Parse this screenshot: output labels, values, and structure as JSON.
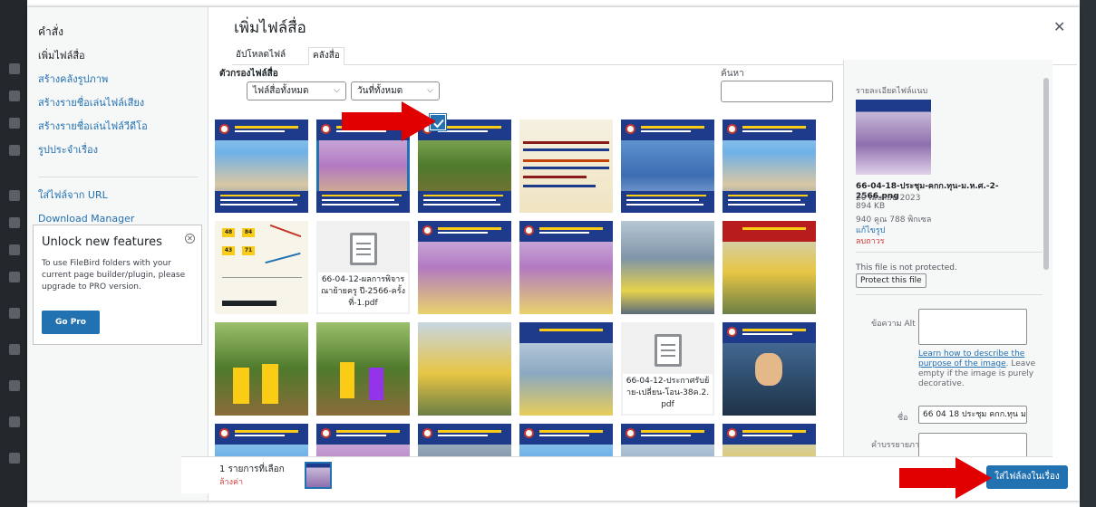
{
  "sidebar": {
    "title": "คำสั่ง",
    "items": [
      {
        "label": "เพิ่มไฟล์สื่อ",
        "active": true
      },
      {
        "label": "สร้างคลังรูปภาพ"
      },
      {
        "label": "สร้างรายชื่อเล่นไฟล์เสียง"
      },
      {
        "label": "สร้างรายชื่อเล่นไฟล์วีดีโอ"
      },
      {
        "label": "รูปประจำเรื่อง"
      }
    ],
    "extra": [
      "ใส่ไฟล์จาก URL",
      "Download Manager"
    ]
  },
  "promo": {
    "title": "Unlock new features",
    "text": "To use FileBird folders with your current page builder/plugin, please upgrade to PRO version.",
    "button": "Go Pro"
  },
  "header": {
    "title": "เพิ่มไฟล์สื่อ",
    "close_icon": "close-icon"
  },
  "tabs": [
    {
      "label": "อัปโหลดไฟล์"
    },
    {
      "label": "คลังสื่อ",
      "active": true
    }
  ],
  "filters": {
    "label": "ตัวกรองไฟล์สื่อ",
    "type": "ไฟล์สื่อทั้งหมด",
    "date": "วันที่ทั้งหมด",
    "search_label": "ค้นหา"
  },
  "documents": [
    {
      "name": "66-04-12-ผลการพิจารณาย้ายครู ปี-2566-ครั้งที่-1.pdf"
    },
    {
      "name": "66-04-12-ประกาศรับย้าย-เปลี่ยน-โอน-38ค.2.pdf"
    }
  ],
  "chart_thumb": {
    "numbers": [
      "48",
      "84",
      "43",
      "71"
    ]
  },
  "details": {
    "heading": "รายละเอียดไฟล์แนบ",
    "filename": "66-04-18-ประชุม-คกก.ทุน-ม.ห.ศ.-2-2566.png",
    "date": "20 เมษายน 2023",
    "size": "894 KB",
    "dimensions": "940 คูณ 788 พิกเซล",
    "edit_link": "แก้ไขรูป",
    "delete_link": "ลบถาวร",
    "protection_text": "This file is not protected.",
    "protect_button": "Protect this file",
    "alt_label": "ข้อความ Alt",
    "alt_help_link": "Learn how to describe the purpose of the image",
    "alt_help_text": ". Leave empty if the image is purely decorative.",
    "title_label": "ชื่อ",
    "title_value": "66 04 18 ประชุม คกก.ทุน ม",
    "caption_label": "คำบรรยายภาพ"
  },
  "toolbar": {
    "selected_count": "1 รายการที่เลือก",
    "clear": "ล้างค่า",
    "insert_button": "ใส่ไฟล์ลงในเรื่อง"
  },
  "colors": {
    "accent": "#2271b1",
    "arrow": "#e00000",
    "danger": "#d63638"
  }
}
